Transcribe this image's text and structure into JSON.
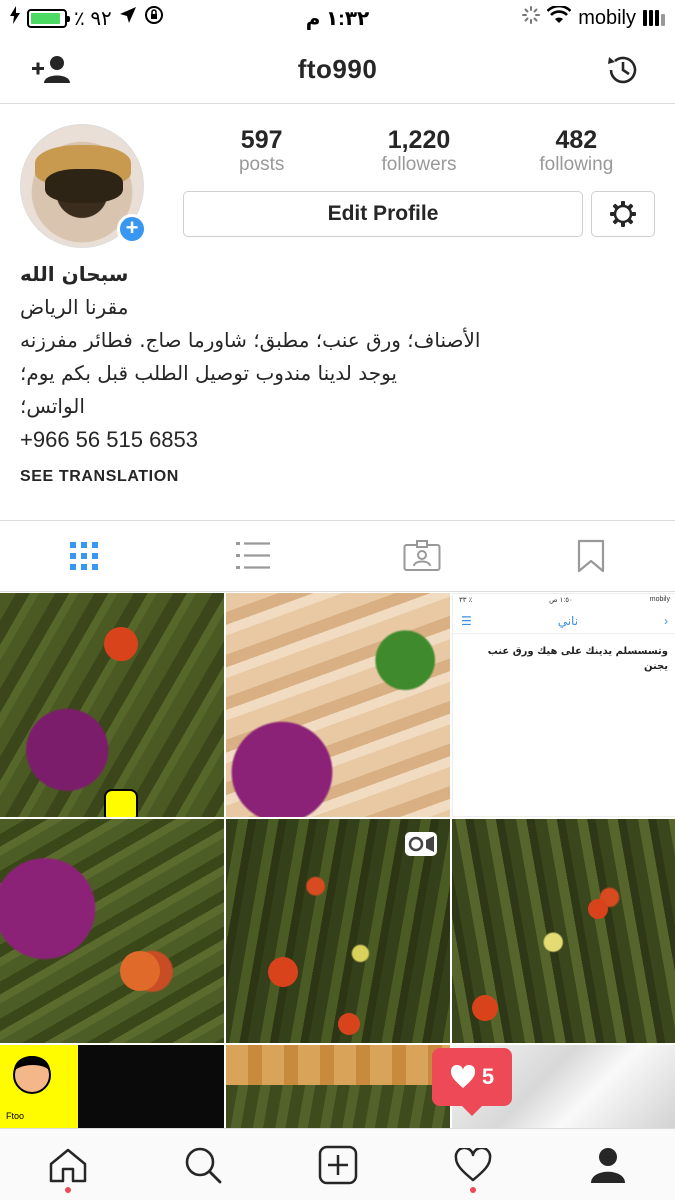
{
  "status_bar": {
    "battery_percent": "٪ ٩٢",
    "time": "١:٣٢ م",
    "carrier": "mobily"
  },
  "header": {
    "username": "fto990",
    "add_user_icon": "add-user-icon",
    "history_icon": "history-icon"
  },
  "profile": {
    "stats": [
      {
        "value": "597",
        "label": "posts"
      },
      {
        "value": "1,220",
        "label": "followers"
      },
      {
        "value": "482",
        "label": "following"
      }
    ],
    "edit_profile_label": "Edit Profile",
    "bio": {
      "name": "سبحان الله",
      "line1": "مقرنا الرياض",
      "line2": "الأصناف؛ ورق عنب؛ مطبق؛ شاورما صاج. فطائر مفرزنه",
      "line3": "يوجد لدينا مندوب توصيل الطلب قبل بكم يوم؛",
      "line4": "الواتس؛",
      "phone": "+966 56 515 6853"
    },
    "see_translation": "SEE TRANSLATION"
  },
  "view_tabs": [
    "grid-icon",
    "list-icon",
    "tagged-icon",
    "saved-icon"
  ],
  "grid": {
    "chat_screenshot": {
      "status_left": "٣٣ ٪",
      "status_time": "١:٥٠ ص",
      "status_right": "mobily",
      "contact": "ناني",
      "message": "وتسسسلم يدينك على هيك ورق عنب يجنن"
    },
    "snap_name": "Ftoo"
  },
  "activity": {
    "likes": "5"
  },
  "colors": {
    "accent": "#3897f0",
    "like": "#ed4956",
    "battery": "#4cd964"
  }
}
